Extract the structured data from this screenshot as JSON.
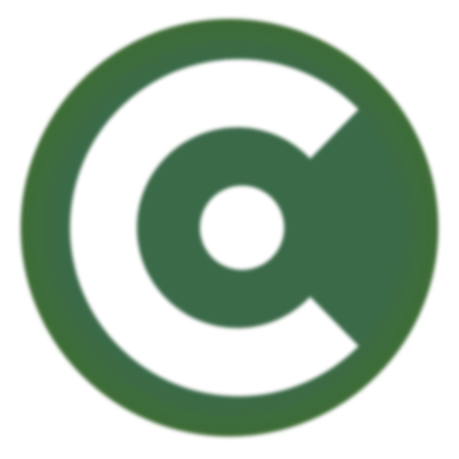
{
  "app_icon": {
    "icon": "c-target-logo-icon",
    "colors": {
      "disc_center": "#3a6a4a",
      "disc_edge": "#3f6d36",
      "mark": "#ffffff",
      "background": "#ffffff"
    }
  }
}
